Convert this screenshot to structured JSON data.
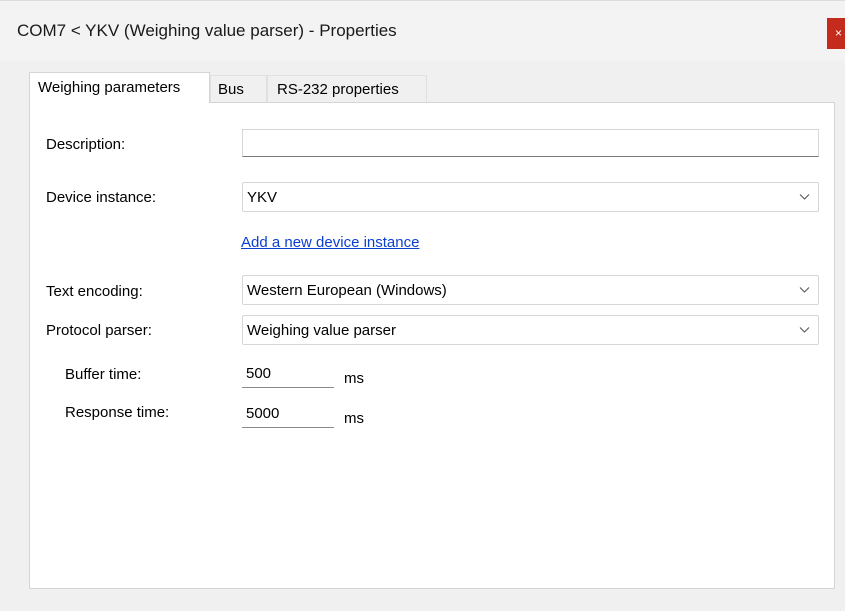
{
  "window": {
    "title": "COM7 < YKV (Weighing value parser) - Properties",
    "close_glyph": "×"
  },
  "tabs": [
    {
      "label": "Weighing parameters",
      "active": true
    },
    {
      "label": "Bus",
      "active": false
    },
    {
      "label": "RS-232 properties",
      "active": false
    }
  ],
  "form": {
    "description": {
      "label": "Description:",
      "value": ""
    },
    "device_instance": {
      "label": "Device instance:",
      "value": "YKV"
    },
    "add_instance_link": "Add a new device instance",
    "text_encoding": {
      "label": "Text encoding:",
      "value": "Western European (Windows)"
    },
    "protocol_parser": {
      "label": "Protocol parser:",
      "value": "Weighing value parser"
    },
    "buffer_time": {
      "label": "Buffer time:",
      "value": "500",
      "unit": "ms"
    },
    "response_time": {
      "label": "Response time:",
      "value": "5000",
      "unit": "ms"
    }
  },
  "icons": {
    "dropdown": "chevron-down-icon",
    "close": "close-icon"
  },
  "colors": {
    "link": "#0b3fd1",
    "close": "#c42b1c"
  }
}
